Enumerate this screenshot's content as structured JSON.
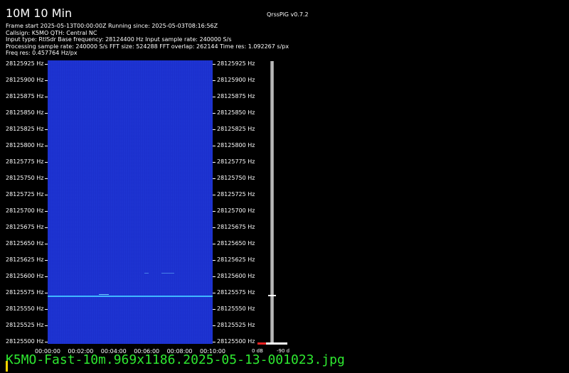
{
  "header": {
    "title": "10M 10 Min",
    "version": "QrssPiG v0.7.2"
  },
  "info_lines": [
    "Frame start 2025-05-13T00:00:00Z Running since: 2025-05-03T08:16:56Z",
    "Callsign: K5MO QTH: Central NC",
    "Input type: RtlSdr Base frequency: 28124400 Hz Input sample rate: 240000 S/s",
    "Processing sample rate: 240000 S/s FFT size: 524288 FFT overlap: 262144 Time res: 1.092267 s/px",
    "Freq res: 0.457764 Hz/px"
  ],
  "freq_labels": [
    "28125925 Hz",
    "28125900 Hz",
    "28125875 Hz",
    "28125850 Hz",
    "28125825 Hz",
    "28125800 Hz",
    "28125775 Hz",
    "28125750 Hz",
    "28125725 Hz",
    "28125700 Hz",
    "28125675 Hz",
    "28125650 Hz",
    "28125625 Hz",
    "28125600 Hz",
    "28125575 Hz",
    "28125550 Hz",
    "28125525 Hz",
    "28125500 Hz"
  ],
  "time_labels": [
    "00:00:00",
    "00:02:00",
    "00:04:00",
    "00:06:00",
    "00:08:00",
    "00:10:00"
  ],
  "scale": {
    "min_label": "0 dB",
    "max_label": "-90 d"
  },
  "filename": "K5MO-Fast-10m.969x1186.2025-05-13-001023.jpg",
  "colors": {
    "background": "#000000",
    "waterfall": "#1a33c8",
    "signal": "#3fb8ff",
    "filename": "#2ee830"
  }
}
